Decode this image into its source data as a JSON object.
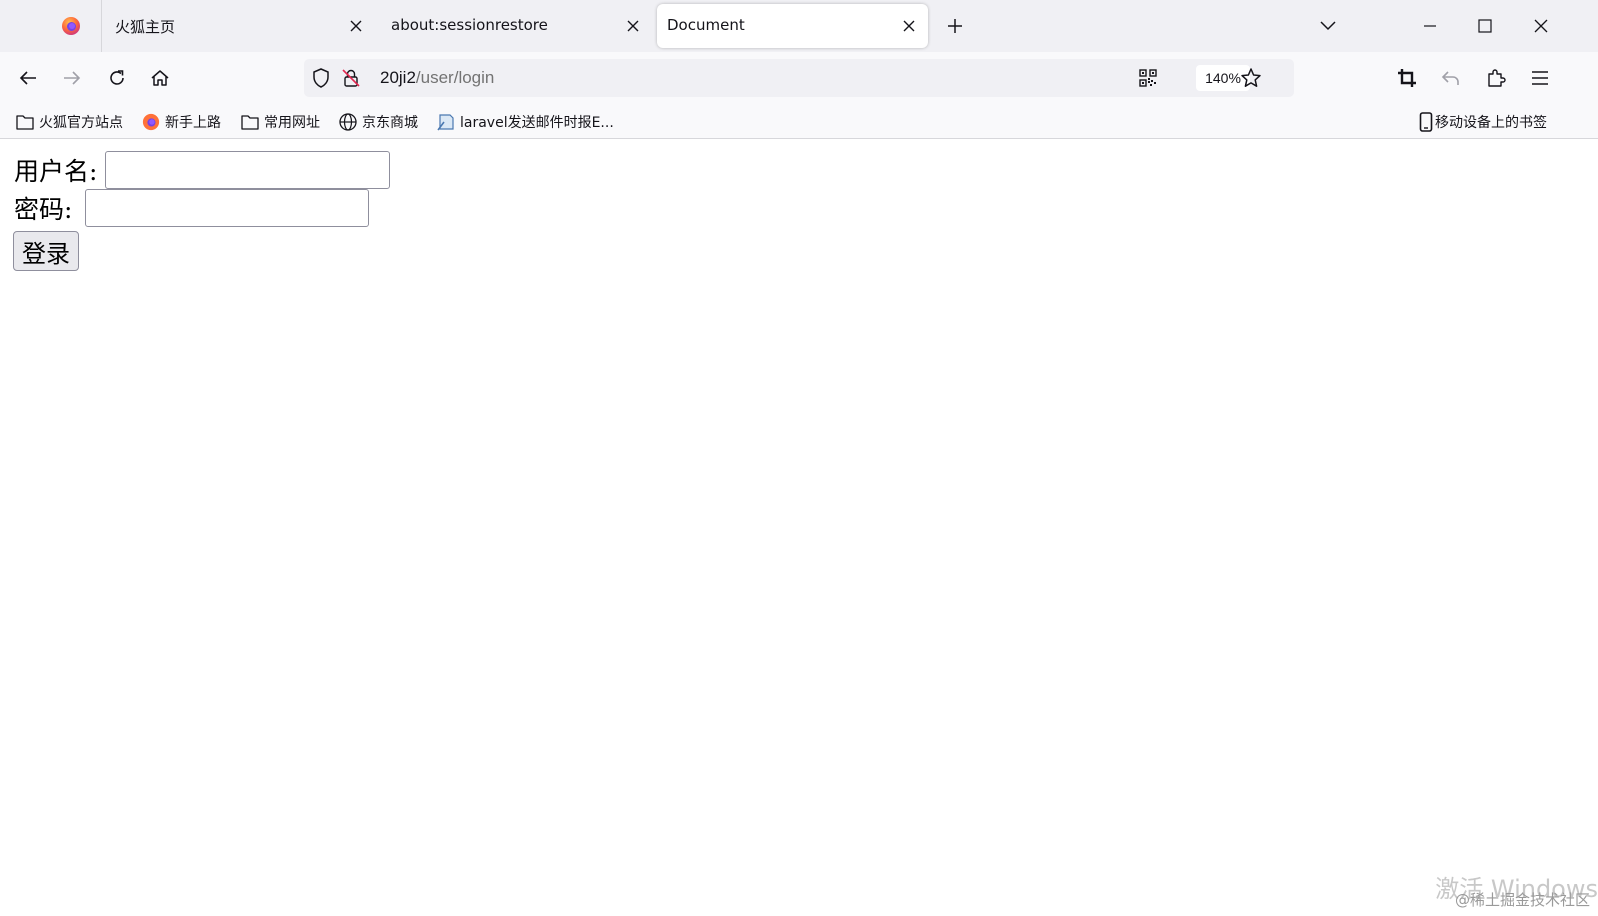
{
  "tabs": [
    {
      "title": "火狐主页",
      "active": false
    },
    {
      "title": "about:sessionrestore",
      "active": false
    },
    {
      "title": "Document",
      "active": true
    }
  ],
  "toolbar": {
    "url_host": "20ji2",
    "url_path": "/user/login",
    "zoom": "140%"
  },
  "bookmarks": [
    {
      "label": "火狐官方站点",
      "icon": "folder-icon"
    },
    {
      "label": "新手上路",
      "icon": "firefox-icon"
    },
    {
      "label": "常用网址",
      "icon": "folder-icon"
    },
    {
      "label": "京东商城",
      "icon": "globe-icon"
    },
    {
      "label": "laravel发送邮件时报E...",
      "icon": "page-icon"
    }
  ],
  "mobile_bookmarks": "移动设备上的书签",
  "form": {
    "username_label": "用户名:",
    "username_value": "",
    "password_label": "密码:",
    "password_value": "",
    "submit_label": "登录"
  },
  "overlay": {
    "activation_watermark": "激活 Windows",
    "credit": "@稀土掘金技术社区"
  }
}
